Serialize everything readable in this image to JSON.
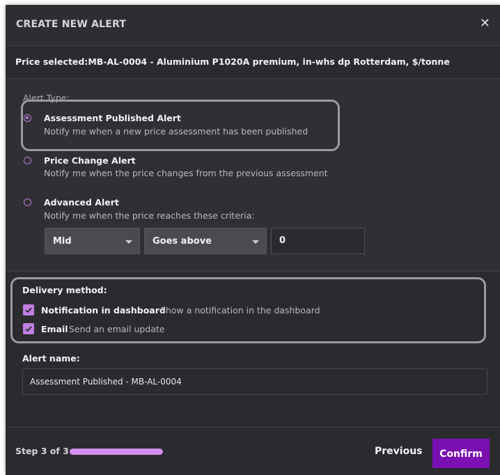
{
  "modal": {
    "title": "CREATE NEW ALERT",
    "close_icon": "close-icon"
  },
  "price_selected": "Price selected:MB-AL-0004 - Aluminium P1020A premium, in-whs dp Rotterdam, $/tonne",
  "alert_type": {
    "label": "Alert Type:",
    "selected": "Assessment Published Alert",
    "options": [
      {
        "title": "Assessment Published Alert",
        "description": "Notify me when a new price assessment has been published",
        "checked": true
      },
      {
        "title": "Price Change Alert",
        "description": "Notify me when the price changes from the previous assessment",
        "checked": false
      },
      {
        "title": "Advanced Alert",
        "description": "Notify me when the price reaches these criteria:",
        "checked": false
      }
    ],
    "criteria": {
      "field_value": "Mid",
      "condition_value": "Goes above",
      "threshold_value": "0"
    }
  },
  "delivery": {
    "label": "Delivery method:",
    "methods": [
      {
        "title": "Notification in dashboard",
        "description": "Show a notification in the dashboard",
        "checked": true
      },
      {
        "title": "Email",
        "description": "Send an email update",
        "checked": true
      }
    ]
  },
  "alert_name": {
    "label": "Alert name:",
    "value": "Assessment Published - MB-AL-0004"
  },
  "footer": {
    "step_text": "Step 3 of 3",
    "progress_fraction": 1.0,
    "previous_label": "Previous",
    "confirm_label": "Confirm"
  },
  "colors": {
    "accent": "#c07fe0",
    "confirm": "#7a0fb2",
    "background": "#2b2b2f"
  }
}
